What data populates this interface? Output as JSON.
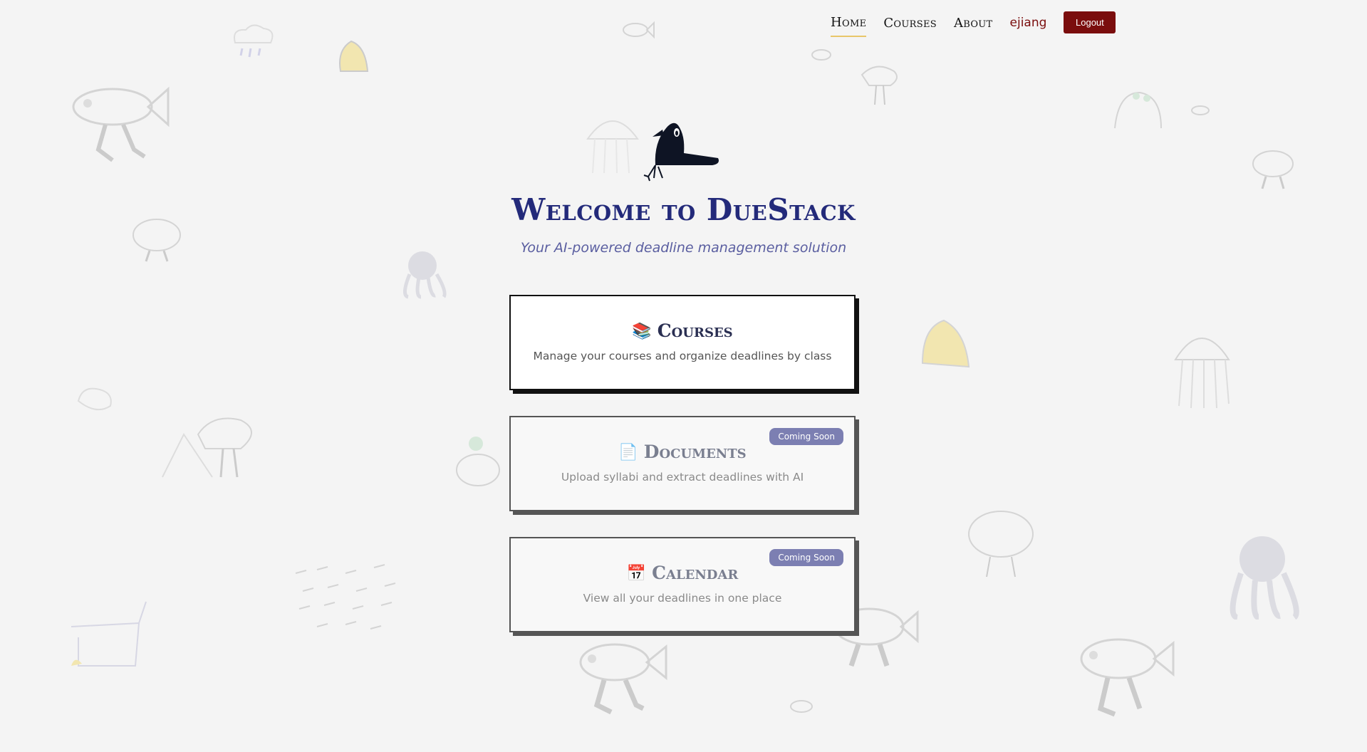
{
  "nav": {
    "home": "Home",
    "courses": "Courses",
    "about": "About",
    "user": "ejiang",
    "logout": "Logout",
    "active_underline_color": "#e8c66a"
  },
  "hero": {
    "logo_icon": "crow-mascot-icon",
    "title": "Welcome to DueStack",
    "subtitle": "Your AI-powered deadline management solution"
  },
  "cards": [
    {
      "icon_name": "books-icon",
      "icon": "📚",
      "title": "Courses",
      "description": "Manage your courses and organize deadlines by class",
      "badge": ""
    },
    {
      "icon_name": "document-icon",
      "icon": "📄",
      "title": "Documents",
      "description": "Upload syllabi and extract deadlines with AI",
      "badge": "Coming Soon"
    },
    {
      "icon_name": "calendar-icon",
      "icon": "📅",
      "title": "Calendar",
      "description": "View all your deadlines in one place",
      "badge": "Coming Soon"
    }
  ],
  "colors": {
    "background": "#f4f4f4",
    "title": "#232a7a",
    "subtitle": "#5a5ea0",
    "logout": "#7a0d0d",
    "badge": "#7c7fb2"
  }
}
